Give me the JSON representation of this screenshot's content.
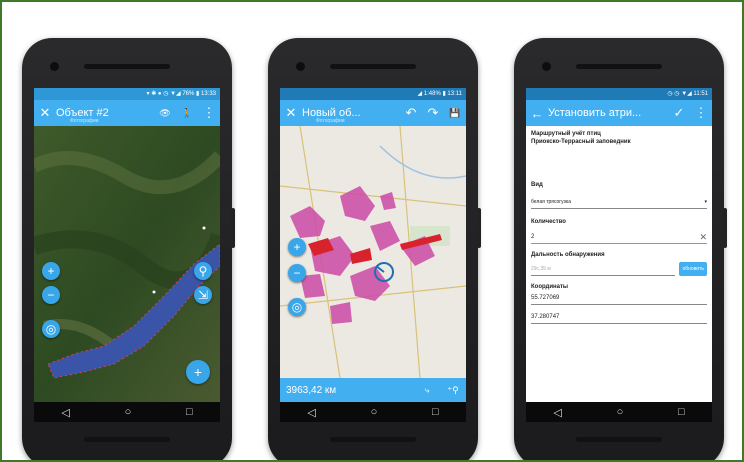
{
  "phone1": {
    "status": "▾ ✱ ● ◷ ▼◢ 76% ▮ 13:33",
    "title": "Объект #2",
    "subtitle": "Фотографии",
    "close": "✕",
    "eye": "👁",
    "walk": "🚶",
    "more": "⋮",
    "zoom_in": "+",
    "zoom_out": "−",
    "locate": "◎",
    "add": "+",
    "nav": [
      "◁",
      "○",
      "□"
    ]
  },
  "phone2": {
    "status": "◢ 1:48% ▮ 13:11",
    "title": "Новый об...",
    "subtitle": "Фотографии",
    "close": "✕",
    "undo": "↶",
    "redo": "↷",
    "save": "💾",
    "zoom_in": "+",
    "zoom_out": "−",
    "locate": "◎",
    "distance": "3963,42 км",
    "nav": [
      "◁",
      "○",
      "□"
    ]
  },
  "phone3": {
    "status": "◷ ◷ ▼◢ 11:51",
    "title": "Установить атри...",
    "back": "←",
    "check": "✓",
    "more": "⋮",
    "header_line1": "Маршрутный учёт птиц",
    "header_line2": "Приокско-Террасный заповедник",
    "label_species": "Вид",
    "species_value": "белая трясогузка",
    "label_count": "Количество",
    "count_value": "2",
    "label_distance": "Дальность обнаружения",
    "distance_placeholder": "29с,35 м",
    "refresh_button": "обновить",
    "label_coords": "Координаты",
    "lat": "55.727069",
    "lon": "37.280747",
    "nav": [
      "◁",
      "○",
      "□"
    ]
  }
}
